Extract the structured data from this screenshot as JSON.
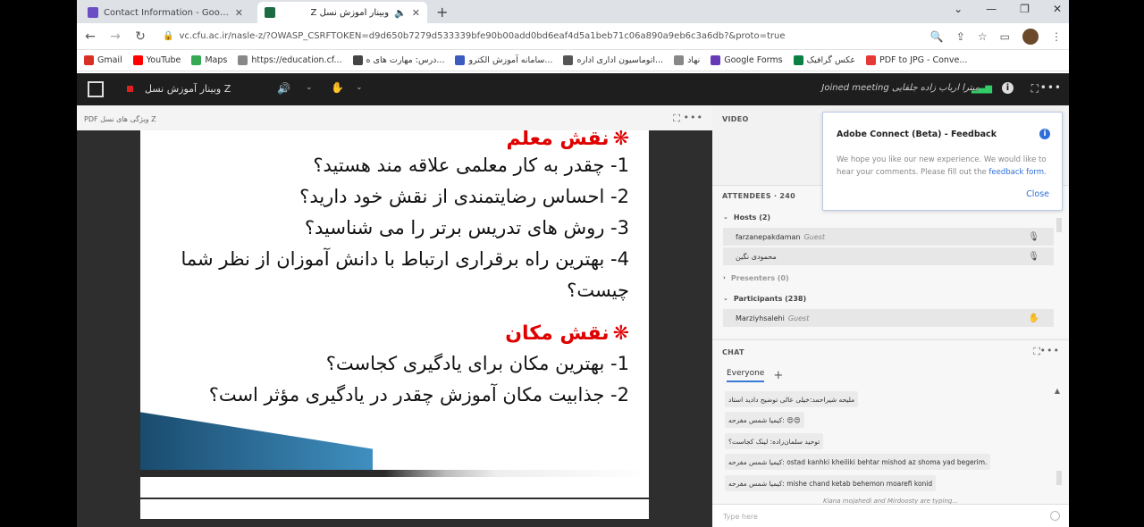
{
  "browser": {
    "tabs": [
      {
        "title": "Contact Information - Google Fo",
        "color": "#6c4ec4"
      },
      {
        "title": "وبینار آموزش نسل Z",
        "color": "#1e6b43"
      }
    ],
    "url": "vc.cfu.ac.ir/nasle-z/?OWASP_CSRFTOKEN=d9d650b7279d533339bfe90b00add0bd6eaf4d5a1beb71c06a890a9eb6c3a6db?&proto=true",
    "bookmarks": [
      {
        "label": "Gmail",
        "color": "#d93025"
      },
      {
        "label": "YouTube",
        "color": "#ff0000"
      },
      {
        "label": "Maps",
        "color": "#34a853"
      },
      {
        "label": "https://education.cf...",
        "color": "#888888"
      },
      {
        "label": "درس: مهارت های ه...",
        "color": "#444444"
      },
      {
        "label": "سامانه آموزش الکترو...",
        "color": "#3a5bbf"
      },
      {
        "label": "اتوماسیون اداری اداره...",
        "color": "#555555"
      },
      {
        "label": "نهاد",
        "color": "#888888"
      },
      {
        "label": "Google Forms",
        "color": "#673ab7"
      },
      {
        "label": "عکس گرافیک",
        "color": "#0b8043"
      },
      {
        "label": "PDF to JPG - Conve...",
        "color": "#e53935"
      }
    ]
  },
  "meeting": {
    "room_name": "وبینار آموزش نسل Z",
    "meeting_label": "Joined meeting میترا ارباب زاده جلفایی"
  },
  "share_pod": {
    "pdf_name": "PDF ویژگی های نسل Z",
    "heading1": "نقش معلم",
    "questions1": [
      "1- چقدر به کار معلمی علاقه مند هستید؟",
      "2- احساس رضایتمندی از نقش خود دارید؟",
      "3- روش های تدریس برتر را می شناسید؟",
      "4- بهترین راه برقراری ارتباط با دانش آموزان از نظر شما چیست؟"
    ],
    "heading2": "نقش مکان",
    "questions2": [
      "1- بهترین مکان برای یادگیری کجاست؟",
      "2- جذابیت مکان آموزش چقدر در یادگیری مؤثر است؟"
    ]
  },
  "video_pod": {
    "title": "VIDEO"
  },
  "attendees": {
    "title": "ATTENDEES · 240",
    "hosts_label": "Hosts (2)",
    "hosts": [
      {
        "name": "farzanepakdaman",
        "role": "Guest"
      },
      {
        "name": "محمودی نگین",
        "role": ""
      }
    ],
    "presenters_label": "Presenters (0)",
    "participants_label": "Participants (238)",
    "participants": [
      {
        "name": "Marziyhsalehi",
        "role": "Guest"
      }
    ]
  },
  "chat": {
    "title": "CHAT",
    "tab_everyone": "Everyone",
    "messages": [
      "ملیحه شیراحمد:خیلی عالی توضیح دادید استاد",
      "کیمیا شمس مفرحه: 😍😍",
      "توحید سلمان‌زاده: لینک کجاست؟",
      "کیمیا شمس مفرحه: ostad kanhki kheiliki behtar mishod az shoma yad begerim.",
      "کیمیا شمس مفرحه: mishe chand ketab behemon moarefi konid"
    ],
    "typing": "Kiana mojahedi and Mirdoosty are typing...",
    "input_placeholder": "Type here"
  },
  "feedback": {
    "title": "Adobe Connect (Beta) - Feedback",
    "body": "We hope you like our new experience. We would like to hear your comments. Please fill out the",
    "link": "feedback form.",
    "close": "Close"
  }
}
